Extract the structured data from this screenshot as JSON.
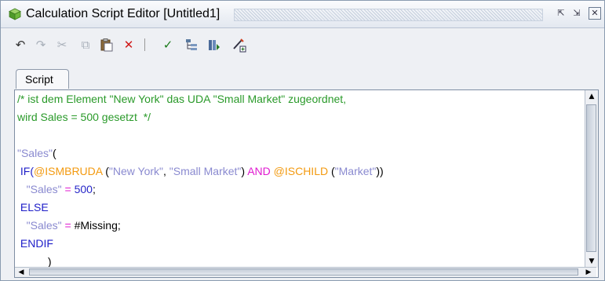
{
  "window": {
    "title": "Calculation Script Editor [Untitled1]",
    "icons": [
      "cube-icon",
      "float-icon",
      "dock-icon",
      "close-icon"
    ]
  },
  "toolbar": {
    "buttons": [
      {
        "name": "undo",
        "icon": "undo-icon",
        "glyph": "↶",
        "enabled": true
      },
      {
        "name": "redo",
        "icon": "redo-icon",
        "glyph": "↷",
        "enabled": false
      },
      {
        "name": "cut",
        "icon": "cut-icon",
        "glyph": "✂",
        "enabled": false
      },
      {
        "name": "copy",
        "icon": "copy-icon",
        "glyph": "⧉",
        "enabled": false
      },
      {
        "name": "paste",
        "icon": "paste-icon",
        "glyph": "📋",
        "enabled": true
      },
      {
        "name": "delete",
        "icon": "delete-icon",
        "glyph": "✕",
        "enabled": true
      },
      {
        "name": "validate",
        "icon": "check-icon",
        "glyph": "✓",
        "enabled": true
      },
      {
        "name": "outline",
        "icon": "outline-icon",
        "glyph": "☰",
        "enabled": true
      },
      {
        "name": "members",
        "icon": "members-icon",
        "glyph": "▦",
        "enabled": true
      },
      {
        "name": "insert-function",
        "icon": "insert-function-icon",
        "glyph": "✎",
        "enabled": true
      }
    ]
  },
  "tabs": [
    {
      "label": "Script",
      "active": true
    }
  ],
  "editor": {
    "line_1": {
      "comment": "/* ist dem Element \"New York\" das UDA \"Small Market\" zugeordnet,"
    },
    "line_2": {
      "comment": "wird Sales = 500 gesetzt  */"
    },
    "line_4": {
      "member": "\"Sales\"",
      "paren": "("
    },
    "line_5": {
      "kw_if": "IF(",
      "fn1": "@ISMBRUDA",
      "open1": " (",
      "arg1": "\"New York\"",
      "comma": ", ",
      "arg2": "\"Small Market\"",
      "close1": ") ",
      "op_and": "AND",
      "space": " ",
      "fn2": "@ISCHILD",
      "open2": " (",
      "arg3": "\"Market\"",
      "close2": "))"
    },
    "line_6": {
      "member": "\"Sales\"",
      "assign": " = ",
      "value": "500",
      "end": ";"
    },
    "line_7": {
      "kw": "ELSE"
    },
    "line_8": {
      "member": "\"Sales\"",
      "assign": " = ",
      "value": "#Missing",
      "end": ";"
    },
    "line_9": {
      "kw": "ENDIF"
    },
    "line_10": {
      "paren": ")"
    }
  },
  "colors": {
    "comment": "#2a9a2a",
    "string": "#8a8ad0",
    "function": "#f39a10",
    "keyword": "#1e1ec8",
    "operator": "#e01ad0"
  }
}
